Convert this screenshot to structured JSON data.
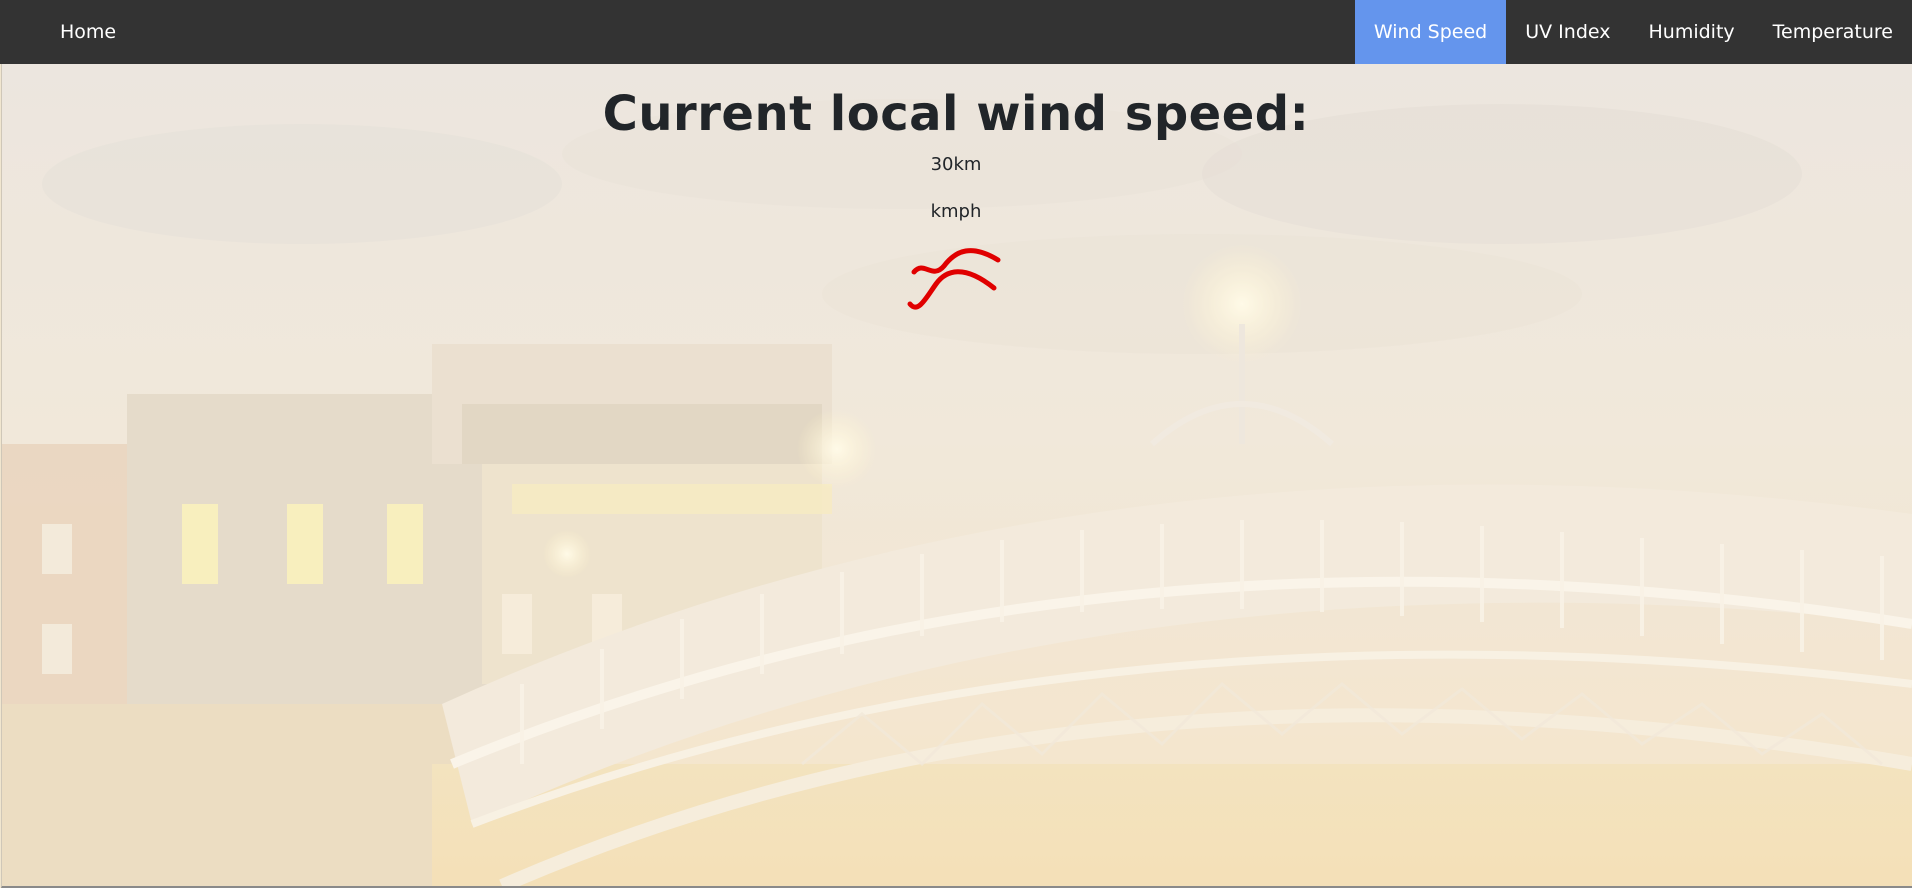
{
  "nav": {
    "home": "Home",
    "items": [
      {
        "label": "Wind Speed",
        "active": true
      },
      {
        "label": "UV Index",
        "active": false
      },
      {
        "label": "Humidity",
        "active": false
      },
      {
        "label": "Temperature",
        "active": false
      }
    ]
  },
  "main": {
    "heading": "Current local wind speed:",
    "value": "30km",
    "unit": "kmph",
    "icon": "wind-icon"
  },
  "colors": {
    "navbar": "#333333",
    "active_tab": "#6495ed",
    "icon": "#e00000",
    "text": "#212529"
  }
}
